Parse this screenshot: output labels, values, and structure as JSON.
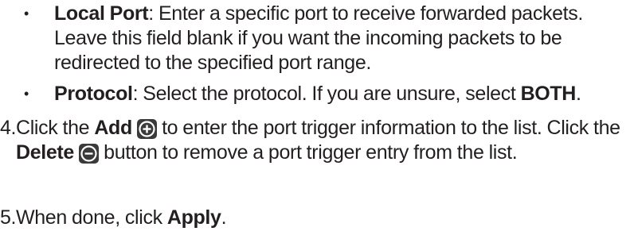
{
  "items": {
    "local_port": {
      "bullet": "•",
      "term": "Local Port",
      "text": ": Enter a specific port to receive forwarded packets. Leave this field blank if you want the incoming packets to be redirected to the specified port range."
    },
    "protocol": {
      "bullet": "•",
      "term": "Protocol",
      "text": ": Select the protocol. If you are unsure, select ",
      "value": "BOTH",
      "end": "."
    }
  },
  "steps": {
    "step4": {
      "num": "4.",
      "p1": "Click the ",
      "add_label": "Add",
      "p2": " to enter the port trigger information to the list. Click the ",
      "delete_label": "Delete",
      "p3": " button to remove a port trigger entry from the list."
    },
    "step5": {
      "num": "5.",
      "p1": "When done, click ",
      "apply_label": "Apply",
      "end": "."
    }
  },
  "icons": {
    "add": "plus-circle-icon",
    "delete": "minus-circle-icon"
  },
  "colors": {
    "text": "#231f20",
    "icon_bg": "#3a3a3a",
    "icon_fg": "#ffffff"
  }
}
